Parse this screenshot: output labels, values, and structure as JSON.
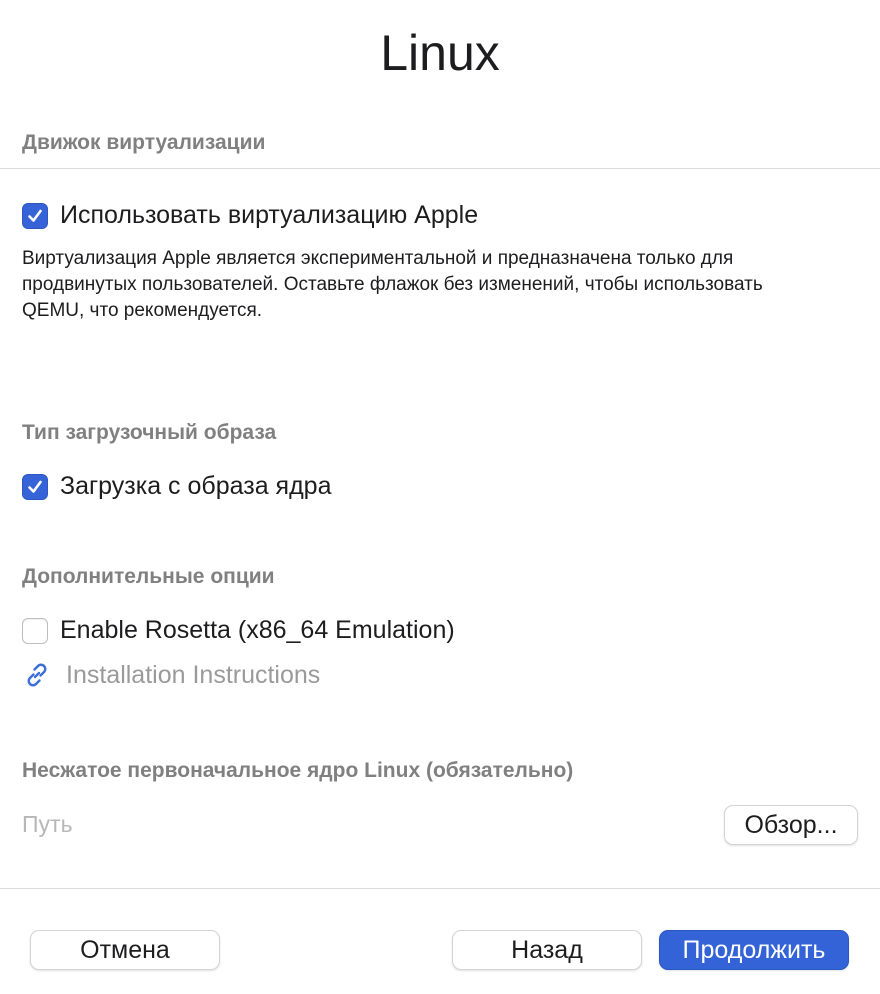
{
  "window": {
    "title": "Linux"
  },
  "virtualization": {
    "header": "Движок виртуализации",
    "use_apple_label": "Использовать виртуализацию Apple",
    "use_apple_checked": true,
    "description": "Виртуализация Apple является экспериментальной и предназначена только для продвинутых пользователей. Оставьте флажок без изменений, чтобы использовать QEMU, что рекомендуется."
  },
  "boot_image": {
    "header": "Тип загрузочный образа",
    "kernel_boot_label": "Загрузка с образа ядра",
    "kernel_boot_checked": true
  },
  "additional_options": {
    "header": "Дополнительные опции",
    "rosetta_label": "Enable Rosetta (x86_64 Emulation)",
    "rosetta_checked": false,
    "instructions_link": "Installation Instructions",
    "link_icon": "link-icon"
  },
  "kernel": {
    "header": "Несжатое первоначальное ядро Linux (обязательно)",
    "path_placeholder": "Путь",
    "browse_label": "Обзор..."
  },
  "footer": {
    "cancel_label": "Отмена",
    "back_label": "Назад",
    "continue_label": "Продолжить"
  },
  "colors": {
    "accent": "#3363d6",
    "section_header": "#808080",
    "placeholder": "#b7b7b7"
  }
}
